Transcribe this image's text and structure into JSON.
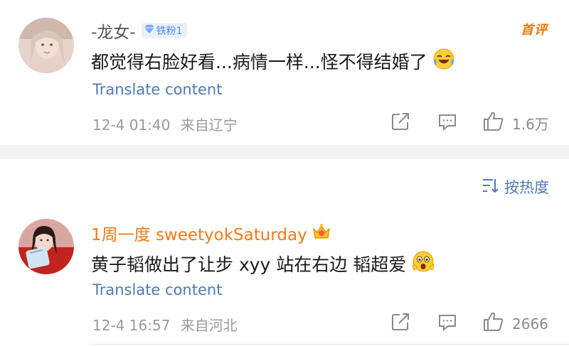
{
  "comments": [
    {
      "username": "-龙女-",
      "badge": "铁粉1",
      "top_tag": "首评",
      "text": "都觉得右脸好看...病情一样...怪不得结婚了",
      "emoji": "laughing-crying-icon",
      "translate": "Translate content",
      "date": "12-4 01:40",
      "location": "来自辽宁",
      "likes": "1.6万"
    },
    {
      "username": "1周一度 sweetyokSaturday",
      "badge_icon": "crown-icon",
      "text": "黄子韬做出了让步 xyy 站在右边 韬超爱",
      "emoji": "shocked-face-icon",
      "translate": "Translate content",
      "date": "12-4 16:57",
      "location": "来自河北",
      "likes": "2666"
    }
  ],
  "sort": {
    "label": "按热度"
  },
  "colors": {
    "vip_name": "#f07a16",
    "link": "#4f7ab5",
    "meta": "#9a9a9a",
    "badge_bg": "#e9f1ff",
    "badge_text": "#4f86f7"
  }
}
